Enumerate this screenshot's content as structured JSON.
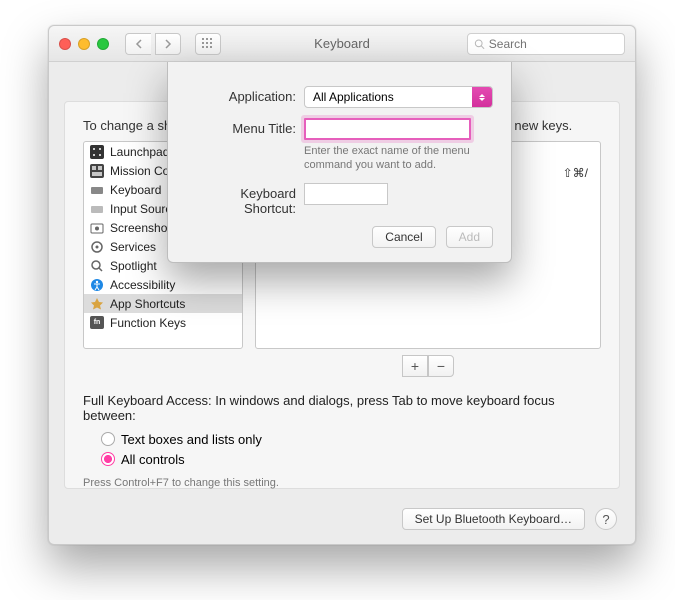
{
  "window": {
    "title": "Keyboard"
  },
  "search": {
    "placeholder": "Search"
  },
  "panel": {
    "instruction": "To change a shortcut, select it, double-click the key combination, then type new keys.",
    "sidebar": [
      {
        "label": "Launchpad & Dock",
        "icon": "launchpad"
      },
      {
        "label": "Mission Control",
        "icon": "mission"
      },
      {
        "label": "Keyboard",
        "icon": "keyboard"
      },
      {
        "label": "Input Sources",
        "icon": "input"
      },
      {
        "label": "Screenshots",
        "icon": "screenshot"
      },
      {
        "label": "Services",
        "icon": "services"
      },
      {
        "label": "Spotlight",
        "icon": "spotlight"
      },
      {
        "label": "Accessibility",
        "icon": "accessibility"
      },
      {
        "label": "App Shortcuts",
        "icon": "app",
        "selected": true
      },
      {
        "label": "Function Keys",
        "icon": "fn"
      }
    ],
    "detail_shortcut": "⇧⌘/",
    "fka_label": "Full Keyboard Access: In windows and dialogs, press Tab to move keyboard focus between:",
    "radio1": "Text boxes and lists only",
    "radio2": "All controls",
    "radio_selected": 2,
    "hint": "Press Control+F7 to change this setting.",
    "bt_button": "Set Up Bluetooth Keyboard…"
  },
  "sheet": {
    "app_label": "Application:",
    "app_value": "All Applications",
    "menu_label": "Menu Title:",
    "menu_help": "Enter the exact name of the menu command you want to add.",
    "ks_label": "Keyboard Shortcut:",
    "cancel": "Cancel",
    "add": "Add"
  }
}
